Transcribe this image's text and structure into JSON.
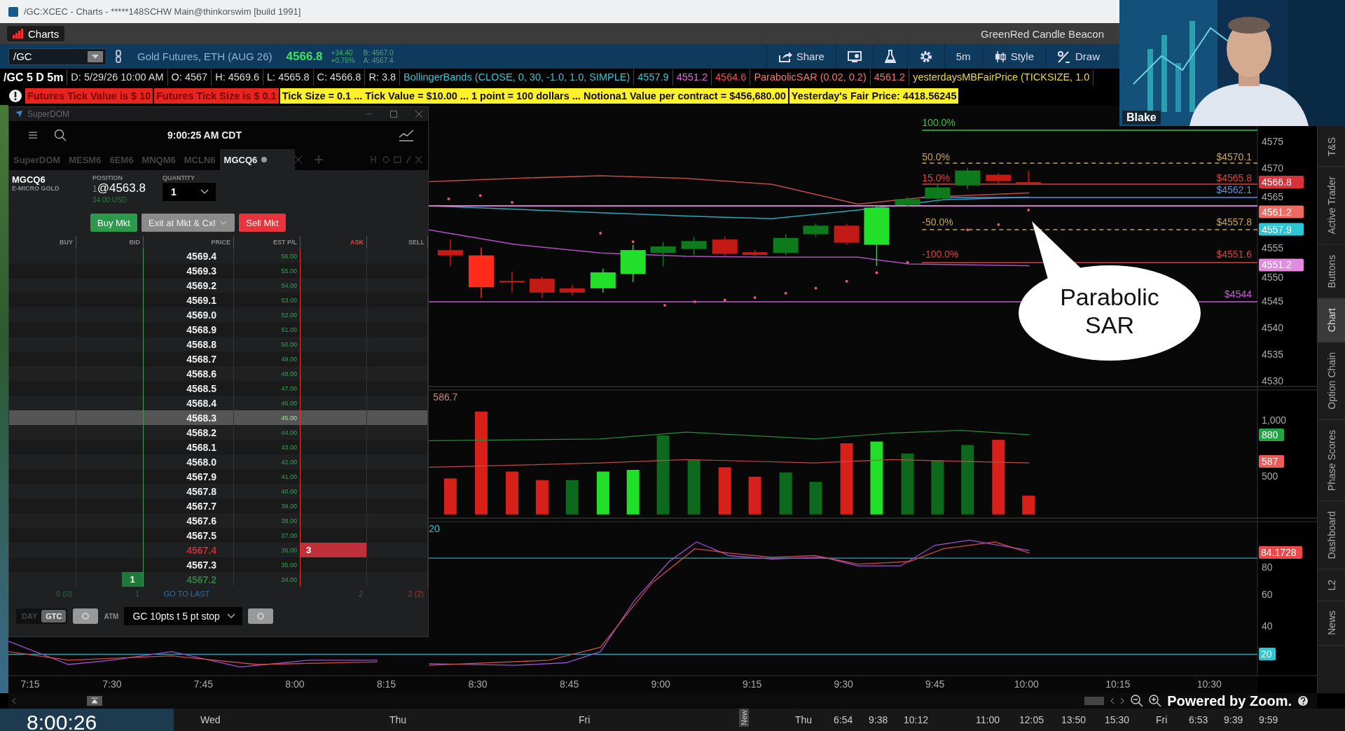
{
  "window": {
    "title": "/GC:XCEC - Charts - *****148SCHW Main@thinkorswim [build 1991]"
  },
  "app_tabs": [
    {
      "label": "Charts",
      "selected": true
    }
  ],
  "study_set": "GreenRed Candle Beacon",
  "toolbar": {
    "symbol": "/GC",
    "description": "Gold Futures, ETH (AUG 26)",
    "last": "4566.8",
    "net_change": "+34.40",
    "percent_change": "+0.76%",
    "bid": "B: 4567.0",
    "ask": "A: 4567.4",
    "buttons": [
      {
        "kind": "share",
        "label": "Share"
      },
      {
        "kind": "alert"
      },
      {
        "kind": "flask"
      },
      {
        "kind": "gear"
      },
      {
        "kind": "period",
        "label": "5m"
      },
      {
        "kind": "style",
        "label": "Style"
      },
      {
        "kind": "draw",
        "label": "Draw"
      }
    ]
  },
  "info_bar": {
    "title": "/GC 5 D 5m",
    "fields": [
      "D: 5/29/26 10:00 AM",
      "O: 4567",
      "H: 4569.6",
      "L: 4565.8",
      "C: 4566.8",
      "R: 3.8"
    ],
    "studies": [
      {
        "text": "BollingerBands (CLOSE, 0, 30, -1.0, 1.0, SIMPLE)",
        "color": "#39c3d6"
      },
      {
        "text": "4557.9",
        "color": "#39c3d6"
      },
      {
        "text": "4551.2",
        "color": "#e070e0"
      },
      {
        "text": "4564.6",
        "color": "#f05050"
      },
      {
        "text": "ParabolicSAR (0.02, 0.2)",
        "color": "#f07a6a"
      },
      {
        "text": "4561.2",
        "color": "#f07a6a"
      },
      {
        "text": "yesterdaysMBFairPrice (TICKSIZE, 1.0",
        "color": "#e8d84a"
      }
    ]
  },
  "alerts": [
    {
      "kind": "red",
      "text": "Futures Tick Value is $ 10"
    },
    {
      "kind": "red",
      "text": "Futures Tick Size is $ 0.1"
    },
    {
      "kind": "yellow",
      "text": "Tick Size =  0.1 ... Tick Value =  $10.00 ... 1 point = 100 dollars ... Notiona1 Value per contract =  $456,680.00"
    },
    {
      "kind": "yellow",
      "text": "Yesterday's Fair Price: 4418.56245"
    }
  ],
  "chart": {
    "fib_levels": [
      {
        "percent": "100.0%",
        "color": "#3fbf4f"
      },
      {
        "percent": "50.0%",
        "price": "$4570.1",
        "color": "#c8a55a"
      },
      {
        "percent": "15.0%",
        "price": "$4565.8",
        "color": "#e0403a"
      },
      {
        "price": "$4562.1",
        "color": "#5a8fe0"
      },
      {
        "percent": "-50.0%",
        "price": "$4557.8",
        "color": "#c8a55a"
      },
      {
        "percent": "-100.0%",
        "price": "$4551.6",
        "color": "#e0403a"
      },
      {
        "price": "$4544",
        "color": "#c060d0"
      }
    ],
    "price_ticks": [
      "4575",
      "4570",
      "4565",
      "4555",
      "4550",
      "4545",
      "4540",
      "4535",
      "4530"
    ],
    "price_badges": [
      {
        "text": "4566.8",
        "color": "#d8333b"
      },
      {
        "text": "4561.2",
        "color": "#f06a62"
      },
      {
        "text": "4557.9",
        "color": "#2ec6d4"
      },
      {
        "text": "4551.2",
        "color": "#e48ae0"
      }
    ],
    "volume_label": "586.7",
    "volume_ticks": [
      "1,000",
      "500"
    ],
    "volume_badges": [
      {
        "text": "880",
        "color": "#22a444"
      },
      {
        "text": "587",
        "color": "#ec5a5a"
      }
    ],
    "stoch_label": "20",
    "stoch_ticks": [
      "80",
      "60",
      "40"
    ],
    "stoch_badges": [
      {
        "text": "84.1728",
        "color": "#ec4a4a"
      },
      {
        "text": "20",
        "color": "#2ec6d4"
      }
    ],
    "time_axis": [
      "7:15",
      "7:30",
      "7:45",
      "8:00",
      "8:15",
      "8:30",
      "8:45",
      "9:00",
      "9:15",
      "9:30",
      "9:45",
      "10:00",
      "10:15",
      "10:30"
    ],
    "callout": "Parabolic SAR"
  },
  "side_tabs": [
    {
      "label": "T&S",
      "selected": false
    },
    {
      "label": "Active Trader",
      "selected": false
    },
    {
      "label": "Buttons",
      "selected": false
    },
    {
      "label": "Chart",
      "selected": true
    },
    {
      "label": "Option Chain",
      "selected": false
    },
    {
      "label": "Phase Scores",
      "selected": false
    },
    {
      "label": "Dashboard",
      "selected": false
    },
    {
      "label": "L2",
      "selected": false
    },
    {
      "label": "News",
      "selected": false
    }
  ],
  "dom": {
    "title": "SuperDOM",
    "clock": "9:00:25 AM CDT",
    "tabs": [
      {
        "label": "SuperDOM",
        "selected": false
      },
      {
        "label": "MESM6",
        "selected": false
      },
      {
        "label": "6EM6",
        "selected": false
      },
      {
        "label": "MNQM6",
        "selected": false
      },
      {
        "label": "MCLN6",
        "selected": false
      },
      {
        "label": "MGCQ6",
        "selected": true
      }
    ],
    "instrument": "MGCQ6",
    "instrument_desc": "E-MICRO GOLD",
    "position_label": "POSITION",
    "position_qty": "1",
    "position_price": "@4563.8",
    "position_pl": "34.00 USD",
    "quantity_label": "QUANTITY",
    "quantity": "1",
    "buttons": [
      {
        "kind": "buy",
        "label": "Buy Mkt"
      },
      {
        "kind": "exit",
        "label": "Exit at Mkt & Cxl"
      },
      {
        "kind": "sell",
        "label": "Sell Mkt"
      }
    ],
    "columns": [
      "BUY",
      "BID",
      "PRICE",
      "EST P/L",
      "ASK",
      "SELL"
    ],
    "rows": [
      {
        "price": "4569.4",
        "est_pl": "56.00",
        "selected": false
      },
      {
        "price": "4569.3",
        "est_pl": "55.00",
        "selected": false
      },
      {
        "price": "4569.2",
        "est_pl": "54.00",
        "selected": false
      },
      {
        "price": "4569.1",
        "est_pl": "53.00",
        "selected": false
      },
      {
        "price": "4569.0",
        "est_pl": "52.00",
        "selected": false
      },
      {
        "price": "4568.9",
        "est_pl": "51.00",
        "selected": false
      },
      {
        "price": "4568.8",
        "est_pl": "50.00",
        "selected": false
      },
      {
        "price": "4568.7",
        "est_pl": "49.00",
        "selected": false
      },
      {
        "price": "4568.6",
        "est_pl": "48.00",
        "selected": false
      },
      {
        "price": "4568.5",
        "est_pl": "47.00",
        "selected": false
      },
      {
        "price": "4568.4",
        "est_pl": "46.00",
        "selected": false
      },
      {
        "price": "4568.3",
        "est_pl": "45.00",
        "selected": true
      },
      {
        "price": "4568.2",
        "est_pl": "44.00",
        "selected": false
      },
      {
        "price": "4568.1",
        "est_pl": "43.00",
        "selected": false
      },
      {
        "price": "4568.0",
        "est_pl": "42.00",
        "selected": false
      },
      {
        "price": "4567.9",
        "est_pl": "41.00",
        "selected": false
      },
      {
        "price": "4567.8",
        "est_pl": "40.00",
        "selected": false
      },
      {
        "price": "4567.7",
        "est_pl": "39.00",
        "selected": false
      },
      {
        "price": "4567.6",
        "est_pl": "38.00",
        "selected": false
      },
      {
        "price": "4567.5",
        "est_pl": "37.00",
        "selected": false
      },
      {
        "price": "4567.4",
        "est_pl": "36.00",
        "selected": false,
        "kind": "ask",
        "ask": "3"
      },
      {
        "price": "4567.3",
        "est_pl": "35.00",
        "selected": false
      },
      {
        "price": "4567.2",
        "est_pl": "34.00",
        "selected": false,
        "kind": "bid",
        "bid": "1"
      }
    ],
    "footer": {
      "buy": "0 (0)",
      "bid": "1",
      "price": "GO TO LAST",
      "ask": "2",
      "sell": "2 (2)"
    },
    "tif": [
      {
        "label": "DAY",
        "selected": false
      },
      {
        "label": "GTC",
        "selected": true
      }
    ],
    "atm_label": "ATM",
    "atm_strategy": "GC 10pts t 5 pt stop"
  },
  "webcam": {
    "name": "Blake"
  },
  "zoom_label": "Powered by Zoom.",
  "timeline": {
    "clock": "8:00:26",
    "labels": [
      {
        "text": "Wed"
      },
      {
        "text": "Thu"
      },
      {
        "text": "Fri"
      },
      {
        "text": "New",
        "kind": "tag"
      },
      {
        "text": "Thu"
      },
      {
        "text": "6:54"
      },
      {
        "text": "9:38"
      },
      {
        "text": "10:12"
      },
      {
        "text": "11:00"
      },
      {
        "text": "12:05"
      },
      {
        "text": "13:50"
      },
      {
        "text": "15:30"
      },
      {
        "text": "Fri"
      },
      {
        "text": "6:53"
      },
      {
        "text": "9:39"
      },
      {
        "text": "9:59"
      }
    ]
  }
}
